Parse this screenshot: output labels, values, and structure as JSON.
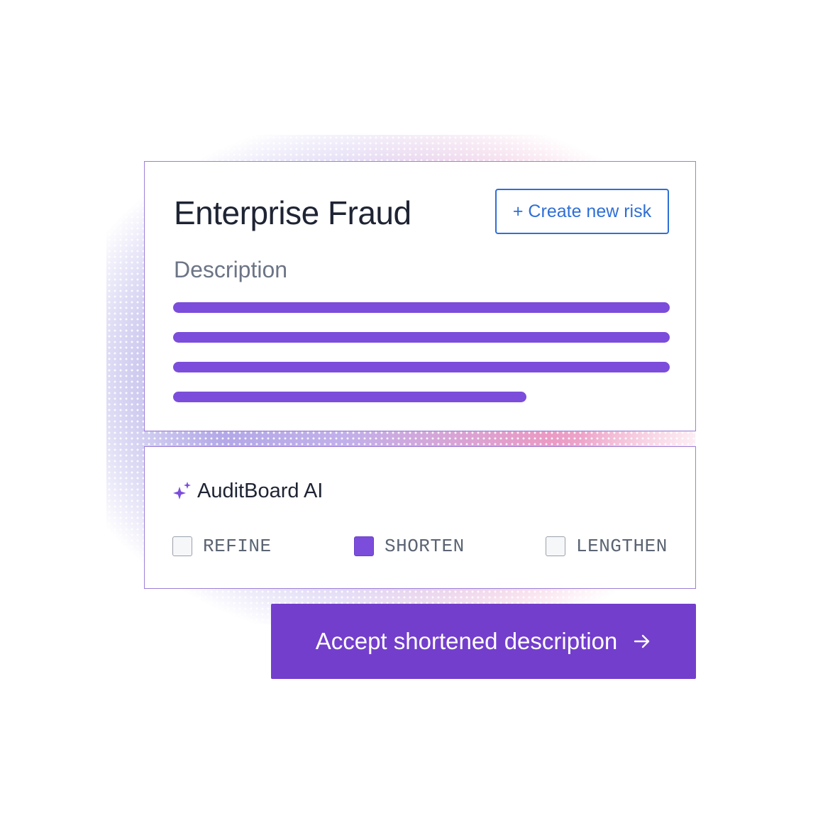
{
  "card": {
    "title": "Enterprise Fraud",
    "create_button_label": "+ Create new risk",
    "section_label": "Description"
  },
  "ai_panel": {
    "icon": "sparkle-icon",
    "title": "AuditBoard AI",
    "options": [
      {
        "label": "REFINE",
        "checked": false
      },
      {
        "label": "SHORTEN",
        "checked": true
      },
      {
        "label": "LENGTHEN",
        "checked": false
      }
    ]
  },
  "accept_button": {
    "label": "Accept shortened description",
    "icon": "arrow-right-icon"
  },
  "colors": {
    "accent": "#733ecc",
    "text_lines": "#7c4ddb",
    "link_blue": "#2f6fd6",
    "card_border": "#9b7fd8"
  }
}
